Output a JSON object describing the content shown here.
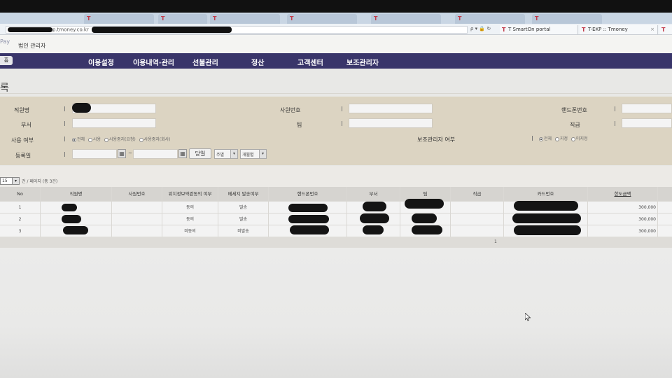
{
  "browser": {
    "tabs": [
      {
        "label": "T SmartOn portal"
      },
      {
        "label": "T-EKP :: Tmoney"
      }
    ],
    "url_prefix": "p.tmoney.co.kr",
    "url_tools": "ρ ▾ 🔒 ↻"
  },
  "header": {
    "logo": "Pay",
    "corp_admin": "법인 관리자"
  },
  "nav": {
    "home": "홈",
    "items": [
      "이용설정",
      "이용내역·관리",
      "선불관리",
      "정산",
      "고객센터",
      "보조관리자"
    ]
  },
  "page_title": "록",
  "filters": {
    "employee_name": "직원명",
    "employee_no": "사원번호",
    "phone": "핸드폰번호",
    "department": "부서",
    "team": "팀",
    "position": "직급",
    "use_status": "사용 여부",
    "use_options": [
      {
        "label": "전체",
        "selected": true
      },
      {
        "label": "사용",
        "selected": false
      },
      {
        "label": "사용중지(요청)",
        "selected": false
      },
      {
        "label": "사용중지(회사)",
        "selected": false
      }
    ],
    "sub_admin": "보조관리자 여부",
    "sub_admin_options": [
      {
        "label": "전체",
        "selected": true
      },
      {
        "label": "지정",
        "selected": false
      },
      {
        "label": "미지정",
        "selected": false
      }
    ],
    "reg_date": "등록일",
    "today_btn": "당일",
    "weekly": "주별",
    "monthly": "개월별"
  },
  "list": {
    "page_size": "15",
    "count_text": "건 / 페이지 (총 3건)",
    "columns": [
      "No",
      "직원명",
      "사원번호",
      "위치정보약관동의 여부",
      "메세지 발송여부",
      "핸드폰번호",
      "부서",
      "팀",
      "직급",
      "카드번호",
      "한도금액"
    ],
    "rows": [
      {
        "no": "1",
        "consent": "동의",
        "msg": "발송",
        "amount": "300,000"
      },
      {
        "no": "2",
        "consent": "동의",
        "msg": "발송",
        "amount": "300,000"
      },
      {
        "no": "3",
        "consent": "미동의",
        "msg": "미발송",
        "amount": "300,000"
      }
    ],
    "page": "1"
  },
  "colors": {
    "nav_bg": "#39356a",
    "filter_bg": "#dcd4c2",
    "redaction": "#141414"
  }
}
